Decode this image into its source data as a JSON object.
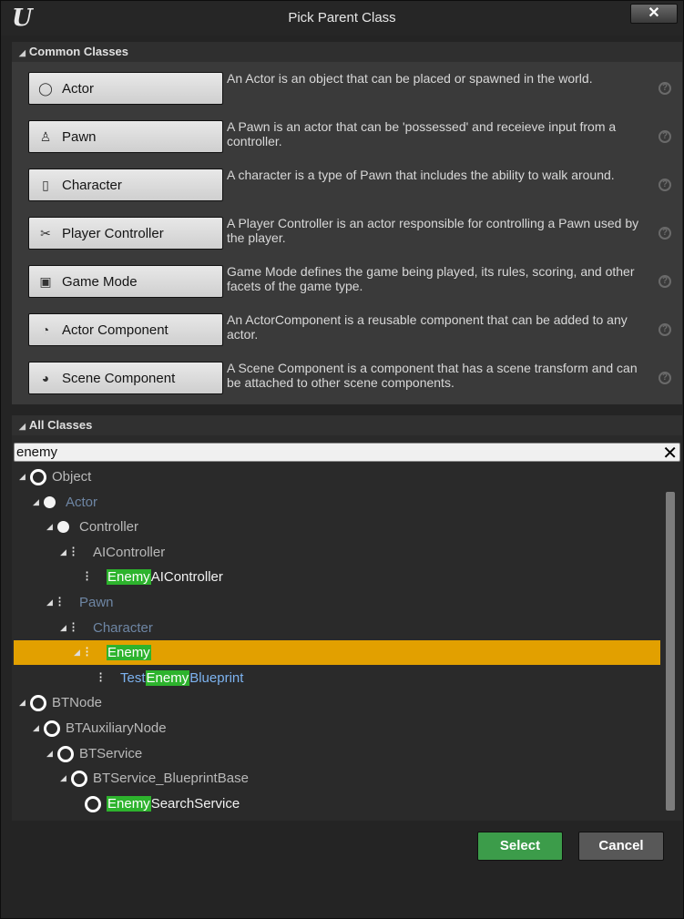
{
  "window": {
    "title": "Pick Parent Class",
    "close_label": "✕",
    "logo": "U"
  },
  "common_classes": {
    "header": "Common Classes",
    "items": [
      {
        "label": "Actor",
        "icon": "sphere-icon",
        "description": "An Actor is an object that can be placed or spawned in the world."
      },
      {
        "label": "Pawn",
        "icon": "pawn-icon",
        "description": "A Pawn is an actor that can be 'possessed' and receieve input from a controller."
      },
      {
        "label": "Character",
        "icon": "character-icon",
        "description": "A character is a type of Pawn that includes the ability to walk around."
      },
      {
        "label": "Player Controller",
        "icon": "player-controller-icon",
        "description": "A Player Controller is an actor responsible for controlling a Pawn used by the player."
      },
      {
        "label": "Game Mode",
        "icon": "game-mode-icon",
        "description": "Game Mode defines the game being played, its rules, scoring, and other facets of the game type."
      },
      {
        "label": "Actor Component",
        "icon": "actor-component-icon",
        "description": "An ActorComponent is a reusable component that can be added to any actor."
      },
      {
        "label": "Scene Component",
        "icon": "scene-component-icon",
        "description": "A Scene Component is a component that has a scene transform and can be attached to other scene components."
      }
    ]
  },
  "all_classes": {
    "header": "All Classes",
    "search_value": "enemy",
    "search_clear": "✕",
    "tree": [
      {
        "pre": "",
        "match": "",
        "post": "Object",
        "depth": 0,
        "icon": "ring",
        "style": "grey",
        "expander": true
      },
      {
        "pre": "",
        "match": "",
        "post": "Actor",
        "depth": 1,
        "icon": "ball",
        "style": "dim",
        "expander": true
      },
      {
        "pre": "",
        "match": "",
        "post": "Controller",
        "depth": 2,
        "icon": "ball",
        "style": "grey",
        "expander": true
      },
      {
        "pre": "",
        "match": "",
        "post": "AIController",
        "depth": 3,
        "icon": "glyph",
        "style": "grey",
        "expander": true
      },
      {
        "pre": "",
        "match": "Enemy",
        "post": "AIController",
        "depth": 4,
        "icon": "glyph",
        "style": "white",
        "expander": false
      },
      {
        "pre": "",
        "match": "",
        "post": "Pawn",
        "depth": 2,
        "icon": "glyph",
        "style": "dim",
        "expander": true
      },
      {
        "pre": "",
        "match": "",
        "post": "Character",
        "depth": 3,
        "icon": "glyph",
        "style": "dim",
        "expander": true
      },
      {
        "pre": "",
        "match": "Enemy",
        "post": "",
        "depth": 4,
        "icon": "glyph",
        "style": "white",
        "expander": true,
        "selected": true
      },
      {
        "pre": "Test",
        "match": "Enemy",
        "post": "Blueprint",
        "depth": 5,
        "icon": "glyph",
        "style": "blue",
        "expander": false
      },
      {
        "pre": "",
        "match": "",
        "post": "BTNode",
        "depth": 0,
        "icon": "ring",
        "style": "grey",
        "expander": true
      },
      {
        "pre": "",
        "match": "",
        "post": "BTAuxiliaryNode",
        "depth": 1,
        "icon": "ring",
        "style": "grey",
        "expander": true
      },
      {
        "pre": "",
        "match": "",
        "post": "BTService",
        "depth": 2,
        "icon": "ring",
        "style": "grey",
        "expander": true
      },
      {
        "pre": "",
        "match": "",
        "post": "BTService_BlueprintBase",
        "depth": 3,
        "icon": "ring",
        "style": "grey",
        "expander": true
      },
      {
        "pre": "",
        "match": "Enemy",
        "post": "SearchService",
        "depth": 4,
        "icon": "ring",
        "style": "white",
        "expander": false
      }
    ]
  },
  "buttons": {
    "select_label": "Select",
    "cancel_label": "Cancel"
  },
  "colors": {
    "selection": "#e2a000",
    "match_highlight": "#2db32d",
    "select_button": "#3c9c4a"
  }
}
